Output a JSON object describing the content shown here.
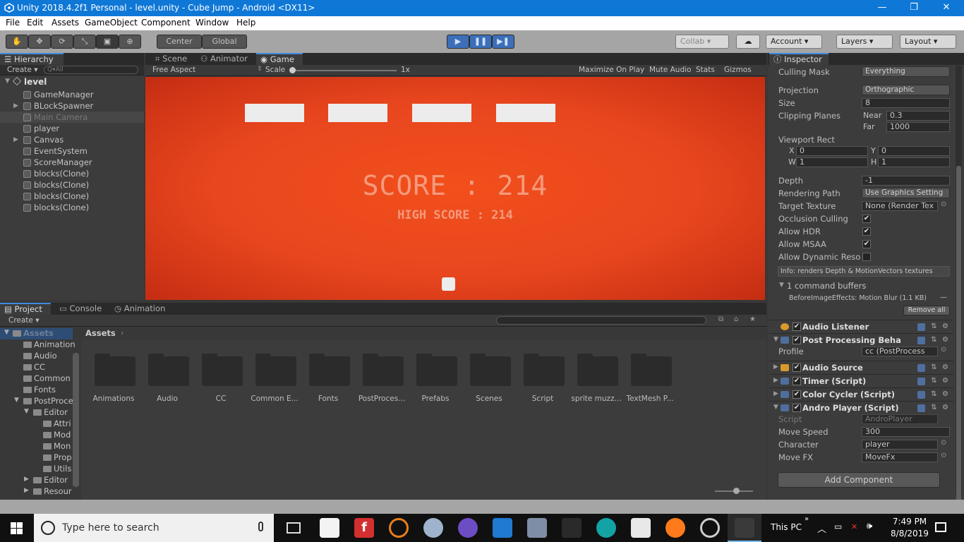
{
  "window": {
    "title": "Unity 2018.4.2f1 Personal - level.unity - Cube Jump - Android <DX11>",
    "minimize": "—",
    "restore": "❐",
    "close": "✕"
  },
  "menu": [
    "File",
    "Edit",
    "Assets",
    "GameObject",
    "Component",
    "Window",
    "Help"
  ],
  "toolbar": {
    "center": "Center",
    "global": "Global",
    "collab": "Collab",
    "account": "Account",
    "layers": "Layers",
    "layout": "Layout"
  },
  "hierarchy": {
    "tab": "Hierarchy",
    "create": "Create",
    "search_placeholder": "Q▾All",
    "scene": "level",
    "items": [
      "GameManager",
      "BLockSpawner",
      "Main Camera",
      "player",
      "Canvas",
      "EventSystem",
      "ScoreManager",
      "blocks(Clone)",
      "blocks(Clone)",
      "blocks(Clone)",
      "blocks(Clone)"
    ]
  },
  "center_tabs": [
    "Scene",
    "Animator",
    "Game"
  ],
  "game_bar": {
    "aspect": "Free Aspect",
    "scale_label": "Scale",
    "scale_value": "1x",
    "maximize": "Maximize On Play",
    "mute": "Mute Audio",
    "stats": "Stats",
    "gizmos": "Gizmos"
  },
  "game": {
    "score": "SCORE : 214",
    "high_score": "HIGH SCORE : 214",
    "bg_color": "#e8461e",
    "block_color": "#e9e9e9"
  },
  "bottom_tabs": [
    "Project",
    "Console",
    "Animation"
  ],
  "project": {
    "create": "Create",
    "tree": [
      "Assets",
      "Animation",
      "Audio",
      "CC",
      "Common",
      "Fonts",
      "PostProce",
      "Editor",
      "Attri",
      "Mod",
      "Mon",
      "Prop",
      "Utils",
      "Editor",
      "Resour"
    ],
    "breadcrumb": "Assets",
    "folders": [
      "Animations",
      "Audio",
      "CC",
      "Common E...",
      "Fonts",
      "PostProces...",
      "Prefabs",
      "Scenes",
      "Script",
      "sprite muzz...",
      "TextMesh P..."
    ]
  },
  "inspector": {
    "tab": "Inspector",
    "culling_mask_label": "Culling Mask",
    "culling_mask_value": "Everything",
    "projection_label": "Projection",
    "projection_value": "Orthographic",
    "size_label": "Size",
    "size_value": "8",
    "clipping_label": "Clipping Planes",
    "near_label": "Near",
    "near_value": "0.3",
    "far_label": "Far",
    "far_value": "1000",
    "viewport_label": "Viewport Rect",
    "x_label": "X",
    "x_value": "0",
    "y_label": "Y",
    "y_value": "0",
    "w_label": "W",
    "w_value": "1",
    "h_label": "H",
    "h_value": "1",
    "depth_label": "Depth",
    "depth_value": "-1",
    "rendering_path_label": "Rendering Path",
    "rendering_path_value": "Use Graphics Setting",
    "target_texture_label": "Target Texture",
    "target_texture_value": "None (Render Tex",
    "occlusion_label": "Occlusion Culling",
    "hdr_label": "Allow HDR",
    "msaa_label": "Allow MSAA",
    "dynamic_label": "Allow Dynamic Reso",
    "info": "Info: renders Depth & MotionVectors textures",
    "command_buffers": "1 command buffers",
    "before_effects": "BeforeImageEffects: Motion Blur (1.1 KB)",
    "remove_all": "Remove all",
    "components": [
      "Audio Listener",
      "Post Processing Beha",
      "Audio Source",
      "Timer (Script)",
      "Color Cycler (Script)",
      "Andro Player (Script)"
    ],
    "profile_label": "Profile",
    "profile_value": "cc (PostProcess",
    "script_label": "Script",
    "script_value": "AndroPlayer",
    "move_speed_label": "Move Speed",
    "move_speed_value": "300",
    "character_label": "Character",
    "character_value": "player",
    "move_fx_label": "Move FX",
    "move_fx_value": "MoveFx",
    "add_component": "Add Component"
  },
  "taskbar": {
    "search_placeholder": "Type here to search",
    "this_pc": "This PC",
    "time": "7:49 PM",
    "date": "8/8/2019"
  }
}
